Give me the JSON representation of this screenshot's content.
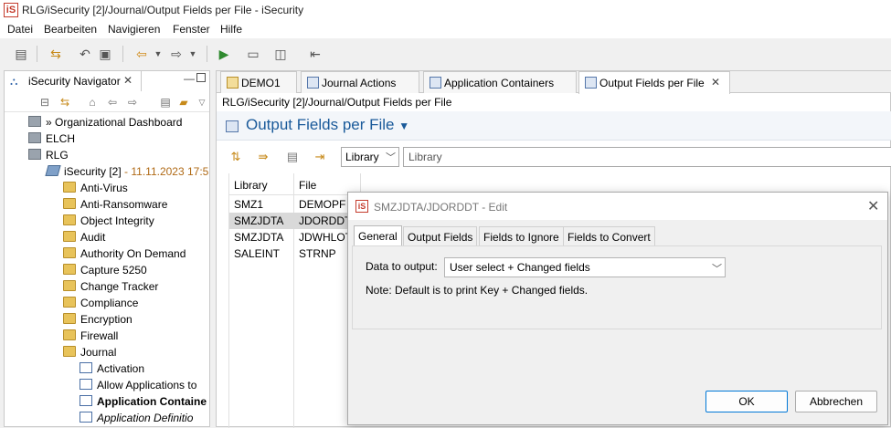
{
  "window": {
    "title": "RLG/iSecurity [2]/Journal/Output Fields per File - iSecurity",
    "app_icon": "iS"
  },
  "menu": [
    "Datei",
    "Bearbeiten",
    "Navigieren",
    "Fenster",
    "Hilfe"
  ],
  "navigator": {
    "title": "iSecurity Navigator",
    "tree": [
      {
        "label": "» Organizational Dashboard",
        "icon": "server-icon"
      },
      {
        "label": "ELCH",
        "icon": "server-icon"
      },
      {
        "label": "RLG",
        "icon": "server-icon"
      },
      {
        "label": "iSecurity [2]",
        "suffix": " - 11.11.2023 17:5",
        "icon": "system-icon"
      },
      {
        "label": "Anti-Virus",
        "icon": "folder-icon"
      },
      {
        "label": "Anti-Ransomware",
        "icon": "folder-icon"
      },
      {
        "label": "Object Integrity",
        "icon": "folder-icon"
      },
      {
        "label": "Audit",
        "icon": "folder-icon"
      },
      {
        "label": "Authority On Demand",
        "icon": "folder-icon"
      },
      {
        "label": "Capture 5250",
        "icon": "folder-icon"
      },
      {
        "label": "Change Tracker",
        "icon": "folder-icon"
      },
      {
        "label": "Compliance",
        "icon": "folder-icon"
      },
      {
        "label": "Encryption",
        "icon": "folder-icon"
      },
      {
        "label": "Firewall",
        "icon": "folder-icon"
      },
      {
        "label": "Journal",
        "icon": "folder-open-icon"
      },
      {
        "label": "Activation",
        "icon": "document-icon"
      },
      {
        "label": "Allow Applications to",
        "icon": "document-icon"
      },
      {
        "label": "Application Containe",
        "icon": "document-icon"
      },
      {
        "label": "Application Definitio",
        "icon": "document-icon"
      }
    ]
  },
  "editor": {
    "tabs": [
      "DEMO1",
      "Journal Actions",
      "Application Containers",
      "Output Fields per File"
    ],
    "breadcrumb": "RLG/iSecurity [2]/Journal/Output Fields per File",
    "title": "Output Fields per File",
    "filter": {
      "select_value": "Library",
      "input_value": "Library"
    },
    "table": {
      "columns": [
        "Library",
        "File"
      ],
      "rows": [
        [
          "SMZ1",
          "DEMOPF"
        ],
        [
          "SMZJDTA",
          "JDORDDT"
        ],
        [
          "SMZJDTA",
          "JDWHLOT"
        ],
        [
          "SALEINT",
          "STRNP"
        ]
      ],
      "selected_row": 1
    }
  },
  "dialog": {
    "title": "SMZJDTA/JDORDDT - Edit",
    "tabs": [
      "General",
      "Output Fields",
      "Fields to Ignore",
      "Fields to Convert"
    ],
    "data_to_output_label": "Data to output:",
    "data_to_output_value": "User select + Changed fields",
    "note": "Note: Default is to print Key + Changed fields.",
    "ok_label": "OK",
    "cancel_label": "Abbrechen"
  }
}
